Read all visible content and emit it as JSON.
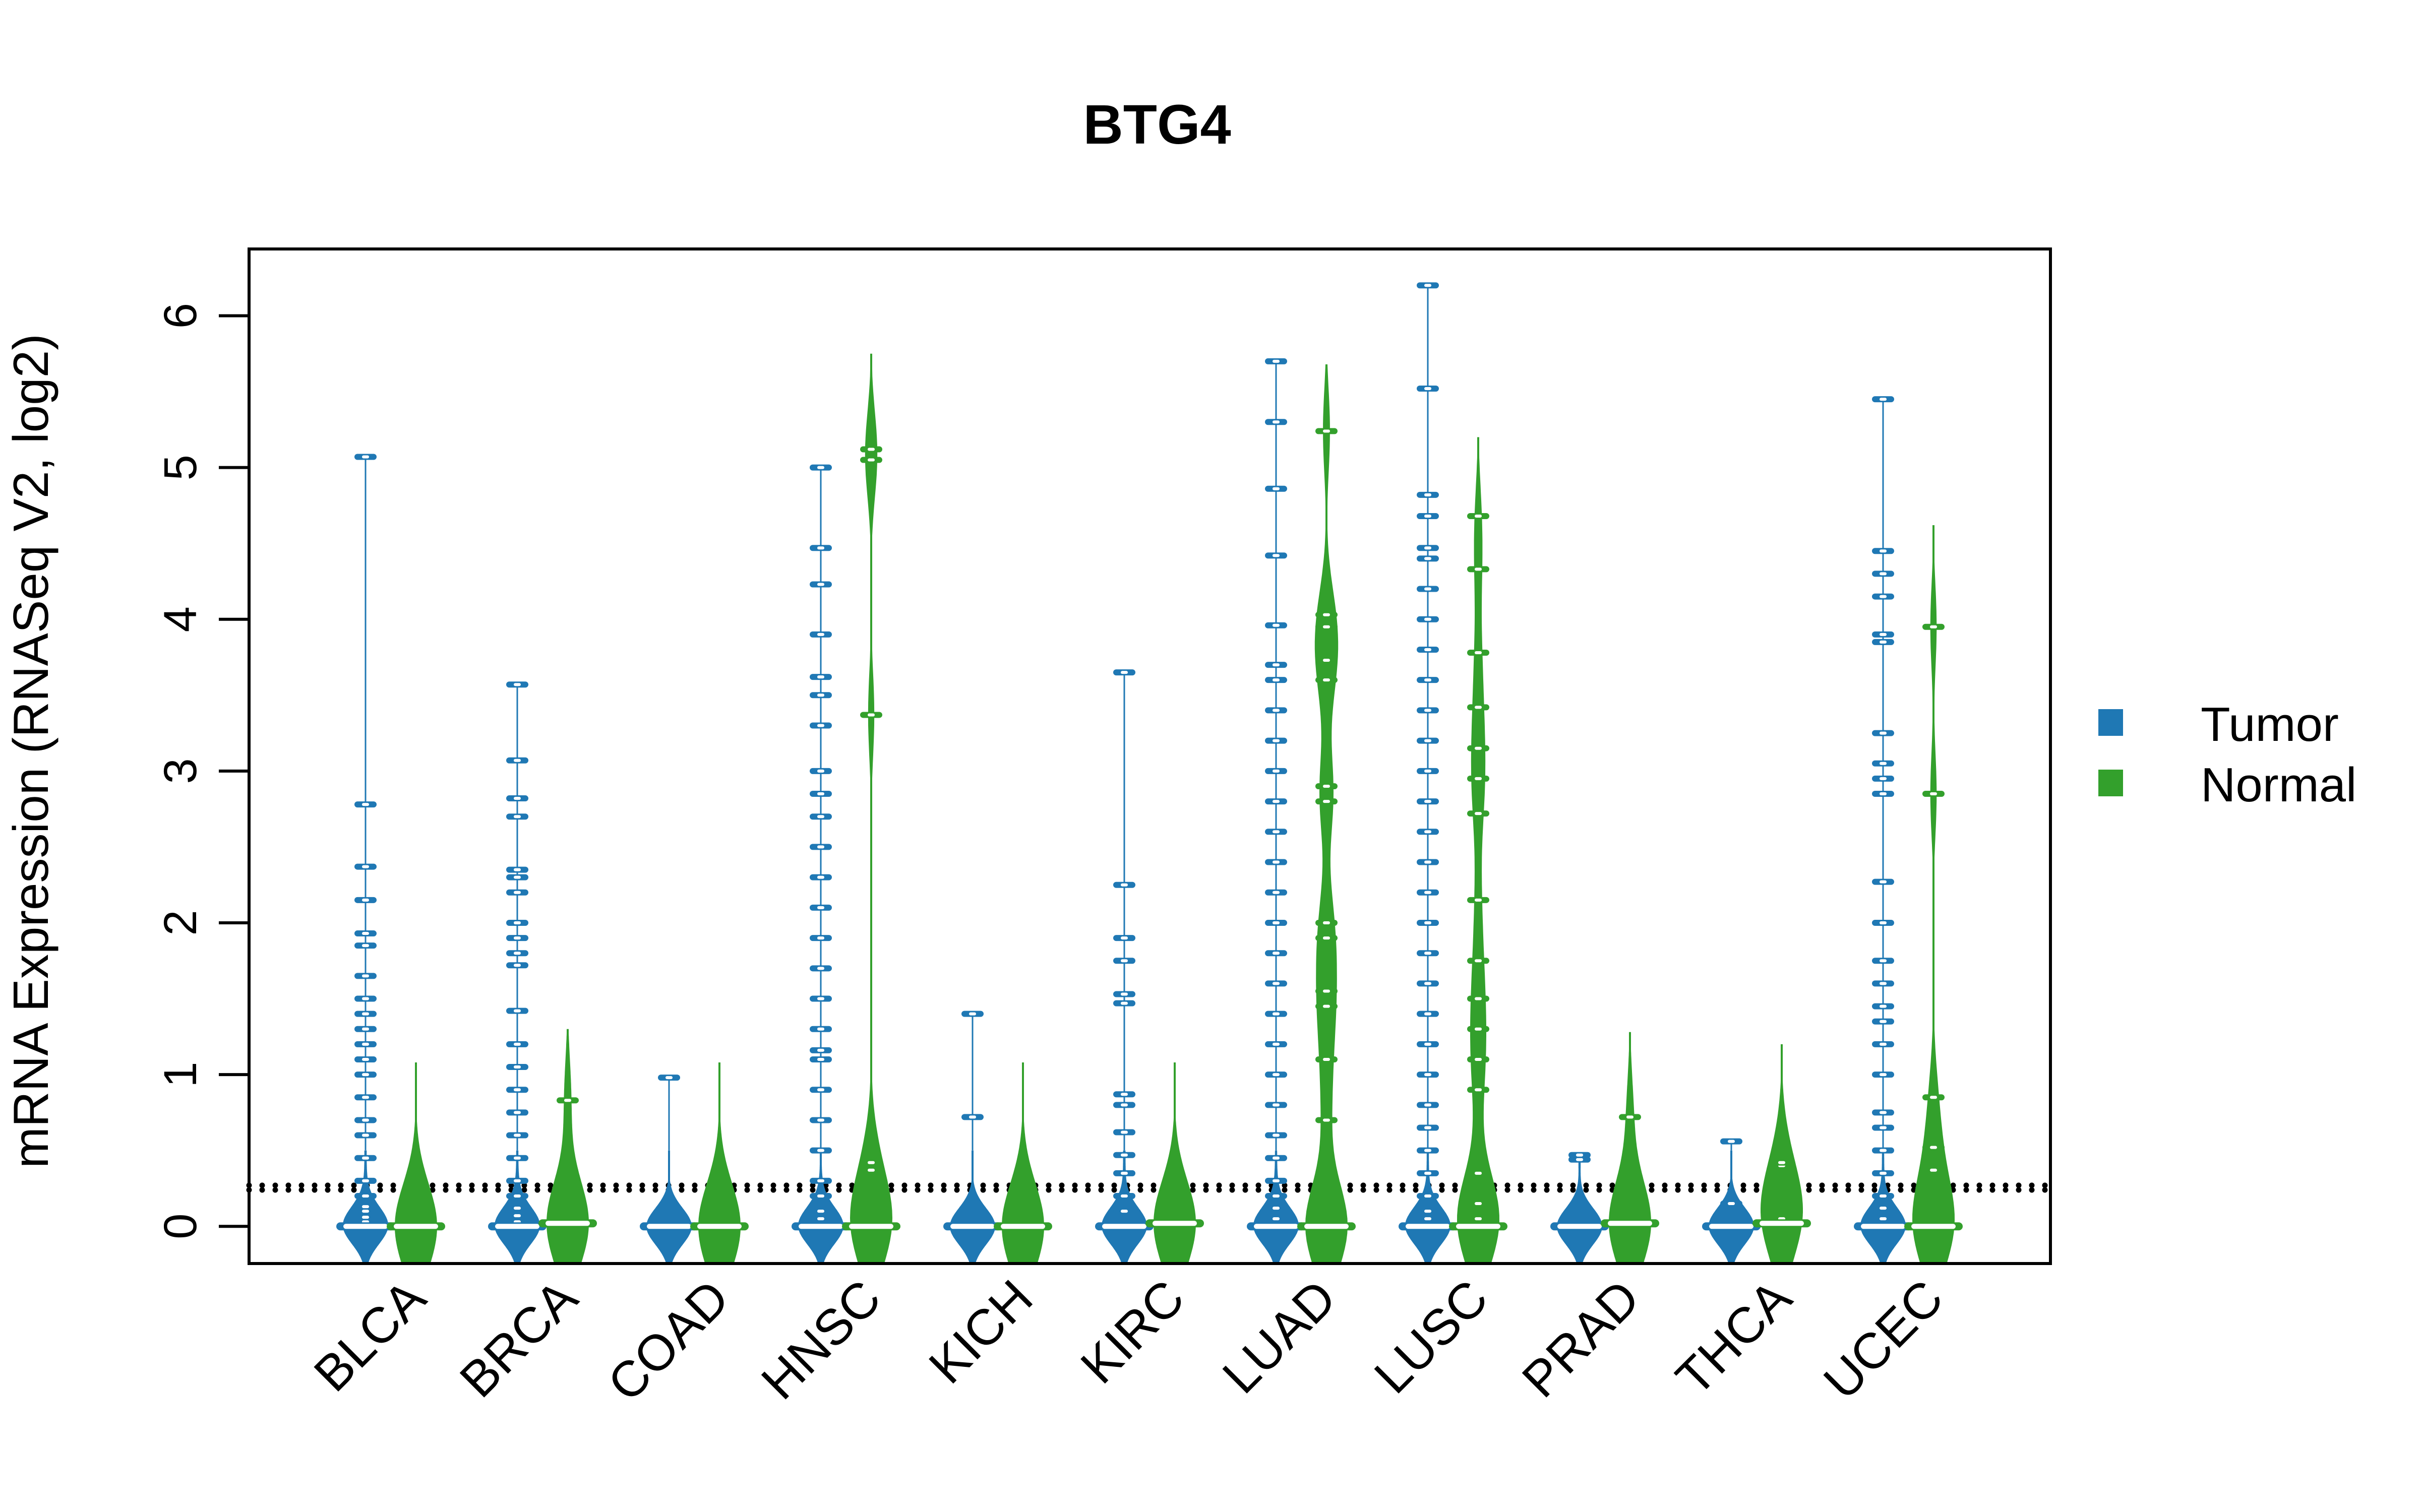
{
  "chart_data": {
    "type": "beanplot",
    "title": "BTG4",
    "xlabel": "",
    "ylabel": "mRNA Expression (RNASeq V2, log2)",
    "ylim": [
      -0.245,
      6.44
    ],
    "yticks": [
      0,
      1,
      2,
      3,
      4,
      5,
      6
    ],
    "grid": false,
    "reference_lines": [
      0.24,
      0.27
    ],
    "legend": {
      "placement": "right",
      "entries": [
        {
          "name": "Tumor",
          "color": "#1f78b4"
        },
        {
          "name": "Normal",
          "color": "#33a02c"
        }
      ]
    },
    "categories": [
      "BLCA",
      "BRCA",
      "COAD",
      "HNSC",
      "KICH",
      "KIRC",
      "LUAD",
      "LUSC",
      "PRAD",
      "THCA",
      "UCEC"
    ],
    "series": [
      {
        "name": "Tumor",
        "color": "#1f78b4",
        "groups": [
          {
            "category": "BLCA",
            "median": 0,
            "max": 5.07,
            "points": [
              0,
              0.03,
              0.06,
              0.1,
              0.13,
              0.2,
              0.3,
              0.45,
              0.6,
              0.7,
              0.85,
              1.0,
              1.1,
              1.2,
              1.3,
              1.4,
              1.5,
              1.65,
              1.85,
              1.93,
              2.15,
              2.37,
              2.78,
              5.07
            ]
          },
          {
            "category": "BRCA",
            "median": 0,
            "max": 3.57,
            "points": [
              0,
              0.03,
              0.07,
              0.12,
              0.2,
              0.3,
              0.45,
              0.6,
              0.75,
              0.9,
              1.05,
              1.2,
              1.42,
              1.72,
              1.8,
              1.9,
              2.0,
              2.2,
              2.3,
              2.35,
              2.7,
              2.82,
              3.07,
              3.57
            ]
          },
          {
            "category": "COAD",
            "median": 0,
            "max": 0.98,
            "points": [
              0,
              0.98
            ]
          },
          {
            "category": "HNSC",
            "median": 0,
            "max": 5.0,
            "points": [
              0,
              0.05,
              0.1,
              0.2,
              0.3,
              0.5,
              0.7,
              0.9,
              1.1,
              1.16,
              1.3,
              1.5,
              1.7,
              1.9,
              2.1,
              2.3,
              2.5,
              2.7,
              2.85,
              3.0,
              3.3,
              3.5,
              3.62,
              3.9,
              4.23,
              4.47,
              5.0
            ]
          },
          {
            "category": "KICH",
            "median": 0,
            "max": 1.4,
            "points": [
              0,
              0.72,
              1.4
            ]
          },
          {
            "category": "KIRC",
            "median": 0,
            "max": 3.65,
            "points": [
              0,
              0.1,
              0.2,
              0.35,
              0.47,
              0.62,
              0.8,
              0.87,
              1.47,
              1.53,
              1.75,
              1.9,
              2.25,
              3.65
            ]
          },
          {
            "category": "LUAD",
            "median": 0,
            "max": 5.7,
            "points": [
              0,
              0.05,
              0.12,
              0.2,
              0.3,
              0.45,
              0.6,
              0.8,
              1.0,
              1.2,
              1.4,
              1.6,
              1.8,
              2.0,
              2.2,
              2.4,
              2.6,
              2.8,
              3.0,
              3.2,
              3.4,
              3.6,
              3.7,
              3.96,
              4.42,
              4.86,
              5.3,
              5.7
            ]
          },
          {
            "category": "LUSC",
            "median": 0,
            "max": 6.2,
            "points": [
              0,
              0.05,
              0.1,
              0.2,
              0.35,
              0.5,
              0.65,
              0.8,
              1.0,
              1.2,
              1.4,
              1.6,
              1.8,
              2.0,
              2.2,
              2.4,
              2.6,
              2.8,
              3.0,
              3.2,
              3.4,
              3.6,
              3.8,
              4.0,
              4.2,
              4.4,
              4.47,
              4.68,
              4.82,
              5.52,
              6.2
            ]
          },
          {
            "category": "PRAD",
            "median": 0,
            "max": 0.47,
            "points": [
              0,
              0.44,
              0.47
            ]
          },
          {
            "category": "THCA",
            "median": 0,
            "max": 0.56,
            "points": [
              0,
              0.15,
              0.56
            ]
          },
          {
            "category": "UCEC",
            "median": 0,
            "max": 5.45,
            "points": [
              0,
              0.05,
              0.12,
              0.2,
              0.35,
              0.5,
              0.65,
              0.75,
              1.0,
              1.2,
              1.35,
              1.45,
              1.6,
              1.75,
              2.0,
              2.27,
              2.85,
              2.95,
              3.05,
              3.25,
              3.85,
              3.9,
              4.15,
              4.3,
              4.45,
              5.45
            ]
          }
        ]
      },
      {
        "name": "Normal",
        "color": "#33a02c",
        "groups": [
          {
            "category": "BLCA",
            "median": 0,
            "max": 1.08,
            "points": [
              0
            ]
          },
          {
            "category": "BRCA",
            "median": 0.02,
            "max": 1.3,
            "points": [
              0.02,
              0.83
            ]
          },
          {
            "category": "COAD",
            "median": 0,
            "max": 1.08,
            "points": [
              0
            ]
          },
          {
            "category": "HNSC",
            "median": 0,
            "max": 5.75,
            "points": [
              0,
              0.37,
              0.42,
              3.37,
              5.05,
              5.12
            ]
          },
          {
            "category": "KICH",
            "median": 0,
            "max": 1.08,
            "points": [
              0
            ]
          },
          {
            "category": "KIRC",
            "median": 0.02,
            "max": 1.08,
            "points": [
              0.02
            ]
          },
          {
            "category": "LUAD",
            "median": 0,
            "max": 5.68,
            "points": [
              0,
              0.7,
              1.1,
              1.45,
              1.55,
              1.9,
              2.0,
              2.8,
              2.9,
              3.6,
              3.73,
              3.95,
              4.03,
              5.24
            ]
          },
          {
            "category": "LUSC",
            "median": 0,
            "max": 5.2,
            "points": [
              0,
              0.05,
              0.15,
              0.35,
              0.9,
              1.1,
              1.3,
              1.5,
              1.75,
              2.15,
              2.72,
              2.95,
              3.15,
              3.42,
              3.78,
              4.33,
              4.68
            ]
          },
          {
            "category": "PRAD",
            "median": 0.02,
            "max": 1.28,
            "points": [
              0.02,
              0.72
            ]
          },
          {
            "category": "THCA",
            "median": 0.02,
            "max": 1.2,
            "points": [
              0.05,
              0.4,
              0.42
            ]
          },
          {
            "category": "UCEC",
            "median": 0,
            "max": 4.62,
            "points": [
              0,
              0.37,
              0.52,
              0.85,
              2.85,
              3.95
            ]
          }
        ]
      }
    ]
  }
}
